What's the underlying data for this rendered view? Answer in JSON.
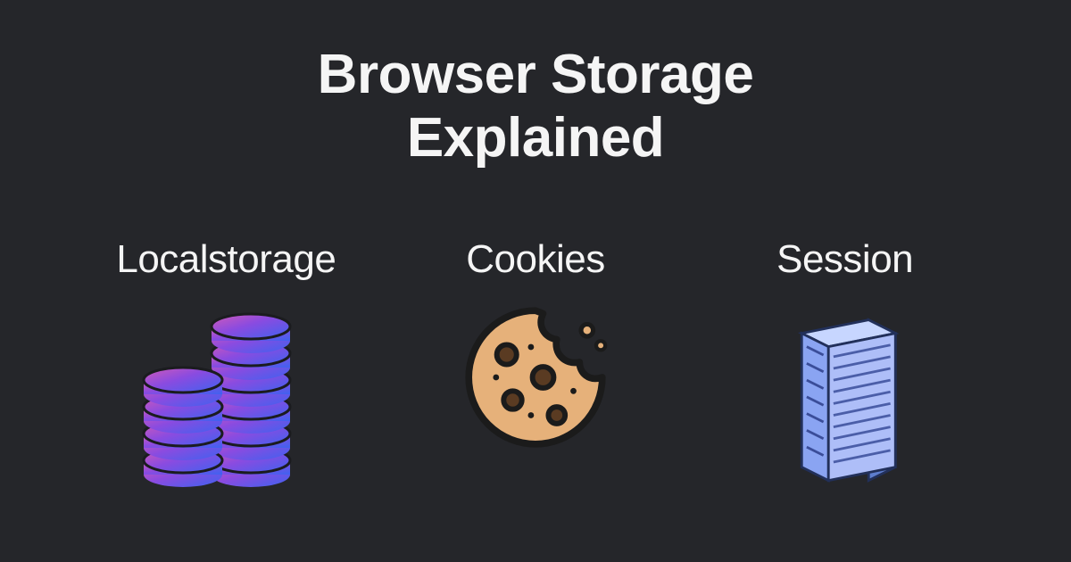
{
  "title_line1": "Browser Storage",
  "title_line2": "Explained",
  "items": [
    {
      "label": "Localstorage",
      "icon": "database-stacks-icon"
    },
    {
      "label": "Cookies",
      "icon": "cookie-icon"
    },
    {
      "label": "Session",
      "icon": "server-rack-icon"
    }
  ]
}
